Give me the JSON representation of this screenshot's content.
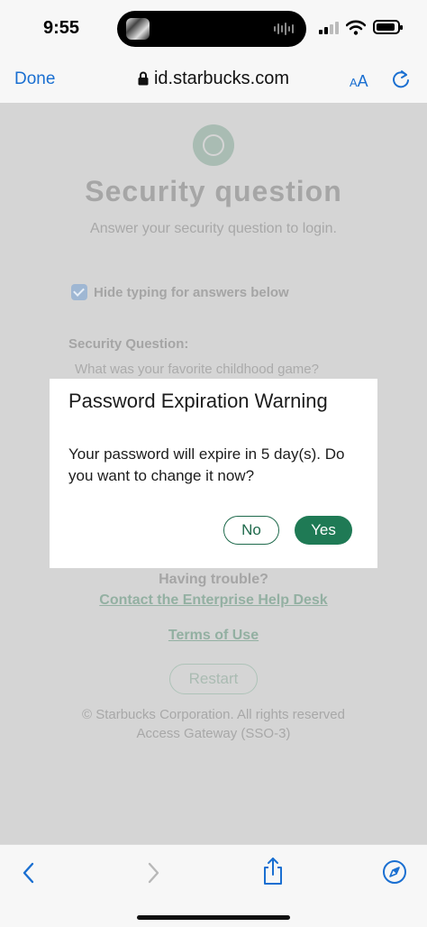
{
  "status_bar": {
    "time": "9:55"
  },
  "browser": {
    "done_label": "Done",
    "url": "id.starbucks.com",
    "text_size_label_big": "A",
    "text_size_label_small": "A"
  },
  "page": {
    "title": "Security question",
    "subtitle": "Answer your security question to login.",
    "hide_typing_label": "Hide typing for answers below",
    "hide_typing_checked": true,
    "security_question_label": "Security Question:",
    "security_question": "What was your favorite childhood game?",
    "having_trouble": "Having trouble?",
    "help_desk_link": "Contact the Enterprise Help Desk",
    "terms_link": "Terms of Use",
    "restart_button": "Restart",
    "copyright": "© Starbucks Corporation. All rights reserved",
    "gateway": "Access Gateway (SSO-3)"
  },
  "dialog": {
    "title": "Password Expiration Warning",
    "message": "Your password will expire in 5 day(s). Do you want to change it now?",
    "no_label": "No",
    "yes_label": "Yes"
  },
  "colors": {
    "accent_blue": "#1a6fd1",
    "starbucks_green": "#1f7a55",
    "overlay_gray": "#d5d5d5"
  },
  "icons": [
    "lock-icon",
    "reload-icon",
    "back-icon",
    "forward-icon",
    "share-icon",
    "safari-compass-icon",
    "cellular-signal-icon",
    "wifi-icon",
    "battery-icon",
    "starbucks-logo"
  ]
}
